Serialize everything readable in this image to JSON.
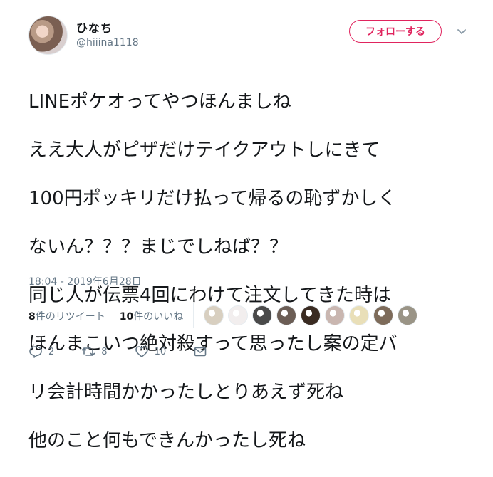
{
  "user": {
    "display_name": "ひなち",
    "handle": "@hiiina1118",
    "follow_label": "フォローする"
  },
  "tweet": {
    "lines": [
      "LINEポケオってやつほんましね",
      "ええ大人がピザだけテイクアウトしにきて",
      "100円ポッキリだけ払って帰るの恥ずかしく",
      "ないん？？？まじでしねば？？",
      "同じ人が伝票4回にわけて注文してきた時は",
      "ほんまこいつ絶対殺すって思ったし案の定バ",
      "リ会計時間かかったしとりあえず死ね",
      "他のこと何もできんかったし死ね"
    ],
    "timestamp": "18:04 - 2019年6月28日"
  },
  "stats": {
    "retweets_count": "8",
    "retweets_label": "件のリツイート",
    "likes_count": "10",
    "likes_label": "件のいいね"
  },
  "likers": [
    {
      "icon": "liker-avatar",
      "color": "#d8cfc0"
    },
    {
      "icon": "liker-avatar",
      "color": "#f2eeee"
    },
    {
      "icon": "liker-avatar",
      "color": "#4a4a4a"
    },
    {
      "icon": "liker-avatar",
      "color": "#6b5d55"
    },
    {
      "icon": "liker-avatar",
      "color": "#3a2b22"
    },
    {
      "icon": "liker-avatar",
      "color": "#c9b6b0"
    },
    {
      "icon": "liker-avatar",
      "color": "#e9dfb8"
    },
    {
      "icon": "liker-avatar",
      "color": "#7d6b5a"
    },
    {
      "icon": "liker-avatar",
      "color": "#9a9486"
    }
  ],
  "actions": {
    "reply_count": "2",
    "retweet_count": "8",
    "like_count": "10"
  },
  "colors": {
    "accent": "#e0245e",
    "secondary_text": "#657786"
  }
}
